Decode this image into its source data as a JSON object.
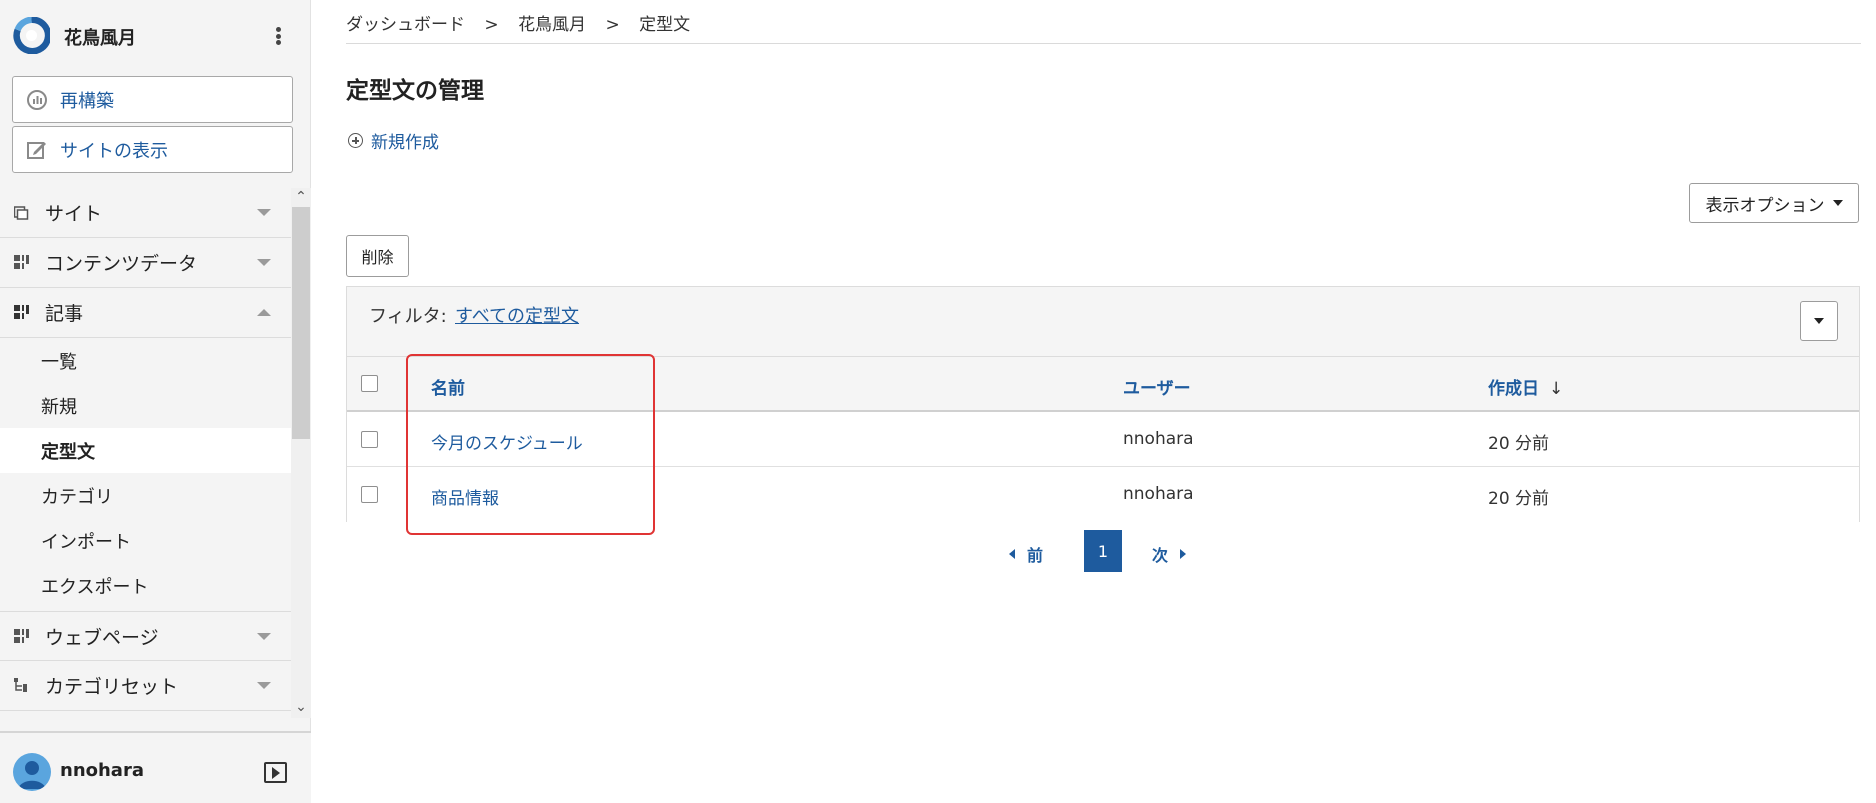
{
  "app": {
    "name": "花鳥風月"
  },
  "sidebar": {
    "rebuild_label": "再構築",
    "view_site_label": "サイトの表示",
    "items": [
      {
        "label": "サイト",
        "icon": "site-icon",
        "state": "collapsed"
      },
      {
        "label": "コンテンツデータ",
        "icon": "content-data-icon",
        "state": "collapsed"
      },
      {
        "label": "記事",
        "icon": "entry-icon",
        "state": "expanded"
      },
      {
        "label": "ウェブページ",
        "icon": "webpage-icon",
        "state": "collapsed"
      },
      {
        "label": "カテゴリセット",
        "icon": "category-set-icon",
        "state": "collapsed"
      }
    ],
    "sub_items": [
      {
        "label": "一覧",
        "active": false
      },
      {
        "label": "新規",
        "active": false
      },
      {
        "label": "定型文",
        "active": true
      },
      {
        "label": "カテゴリ",
        "active": false
      },
      {
        "label": "インポート",
        "active": false
      },
      {
        "label": "エクスポート",
        "active": false
      }
    ]
  },
  "user": {
    "name": "nnohara"
  },
  "breadcrumb": {
    "items": [
      "ダッシュボード",
      "花鳥風月",
      "定型文"
    ],
    "separator": ">"
  },
  "page": {
    "title": "定型文の管理",
    "new_label": "新規作成",
    "display_options_label": "表示オプション",
    "delete_label": "削除"
  },
  "filter": {
    "label": "フィルタ:",
    "value": "すべての定型文"
  },
  "table": {
    "columns": {
      "name": "名前",
      "user": "ユーザー",
      "created": "作成日"
    },
    "sort_indicator": "↓",
    "rows": [
      {
        "name": "今月のスケジュール",
        "user": "nnohara",
        "created": "20 分前"
      },
      {
        "name": "商品情報",
        "user": "nnohara",
        "created": "20 分前"
      }
    ]
  },
  "pagination": {
    "prev_label": "前",
    "current_page": "1",
    "next_label": "次"
  },
  "colors": {
    "accent": "#1e5b9e",
    "highlight": "#e03434",
    "sidebar_bg": "#f4f4f4"
  }
}
